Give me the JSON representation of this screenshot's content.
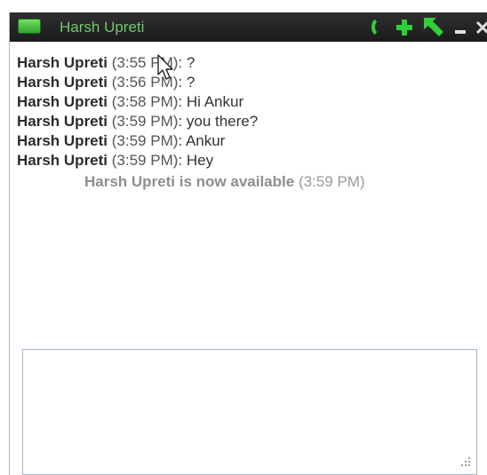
{
  "window": {
    "title": "Harsh Upreti"
  },
  "title_controls": {
    "call": "phone-icon",
    "add": "plus-icon",
    "popout": "arrow-popout-icon",
    "minimize": "minimize-icon",
    "close": "close-icon"
  },
  "colors": {
    "titlebar": "#1f1f1f",
    "title_text": "#6fc96b",
    "icon_green": "#2fcf3a",
    "sender": "#2b2b2b",
    "status": "#8e8e8e",
    "input_border": "#9fb7cc"
  },
  "messages": [
    {
      "sender": "Harsh Upreti",
      "time": "(3:55 PM)",
      "sep": ":",
      "text": "?"
    },
    {
      "sender": "Harsh Upreti",
      "time": "(3:56 PM)",
      "sep": ":",
      "text": "?"
    },
    {
      "sender": "Harsh Upreti",
      "time": "(3:58 PM)",
      "sep": ":",
      "text": "Hi Ankur"
    },
    {
      "sender": "Harsh Upreti",
      "time": "(3:59 PM)",
      "sep": ":",
      "text": "you there?"
    },
    {
      "sender": "Harsh Upreti",
      "time": "(3:59 PM)",
      "sep": ":",
      "text": "Ankur"
    },
    {
      "sender": "Harsh Upreti",
      "time": "(3:59 PM)",
      "sep": ":",
      "text": "Hey"
    }
  ],
  "status_notice": {
    "text": "Harsh Upreti is now available",
    "time": "(3:59 PM)"
  },
  "input": {
    "value": "",
    "placeholder": ""
  }
}
